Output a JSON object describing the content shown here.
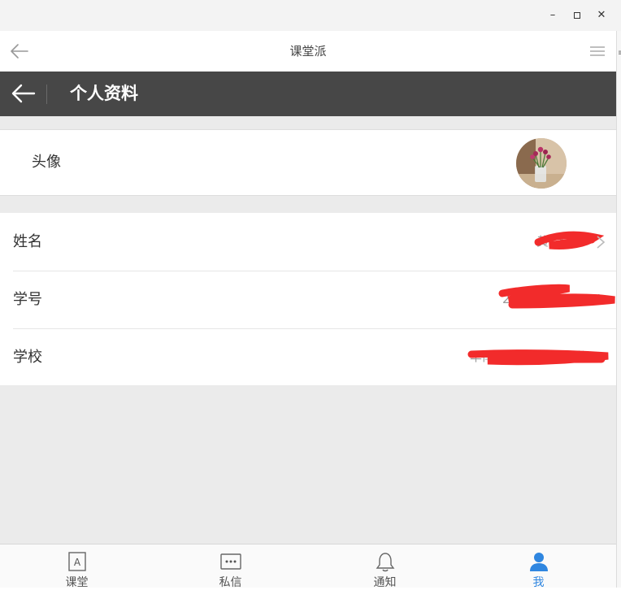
{
  "window": {
    "minimize": "–",
    "maximize": "□",
    "close": "✕"
  },
  "appbar": {
    "title": "课堂派",
    "back_icon": "arrow-left-icon",
    "menu_icon": "hamburger-menu-icon"
  },
  "header": {
    "title": "个人资料",
    "back_icon": "arrow-left-icon"
  },
  "profile": {
    "avatar_label": "头像",
    "fields": [
      {
        "label": "姓名",
        "value": "黄XXX",
        "has_chevron": true
      },
      {
        "label": "学号",
        "value": "2017XXXXXXXX",
        "has_chevron": false
      },
      {
        "label": "学校",
        "value": "华南XXXXXXXX大学",
        "has_chevron": false
      }
    ]
  },
  "tabbar": {
    "items": [
      {
        "label": "课堂",
        "icon": "class-icon",
        "active": false
      },
      {
        "label": "私信",
        "icon": "message-icon",
        "active": false
      },
      {
        "label": "通知",
        "icon": "bell-icon",
        "active": false
      },
      {
        "label": "我",
        "icon": "user-icon",
        "active": true
      }
    ]
  },
  "colors": {
    "header_bg": "#474747",
    "accent": "#2f86e0",
    "redaction": "#f22b2b"
  }
}
